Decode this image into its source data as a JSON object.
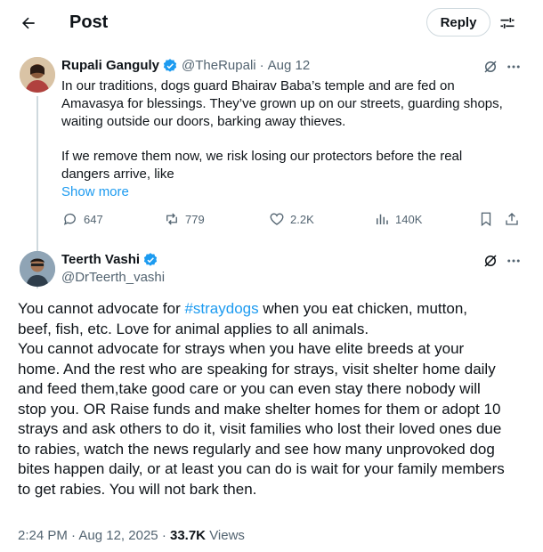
{
  "header": {
    "title": "Post",
    "reply_label": "Reply"
  },
  "parent_post": {
    "display_name": "Rupali Ganguly",
    "handle": "@TheRupali",
    "separator": "·",
    "date": "Aug 12",
    "text_lines": [
      "In our traditions, dogs guard Bhairav Baba’s temple and are fed on",
      "Amavasya for blessings. They’ve grown up on our streets, guarding shops,",
      "waiting outside our doors, barking away thieves.",
      "If we remove them now, we risk losing our protectors before the real",
      "dangers arrive, like"
    ],
    "show_more": "Show more",
    "stats": {
      "replies": "647",
      "reposts": "779",
      "likes": "2.2K",
      "views": "140K"
    }
  },
  "reply_post": {
    "display_name": "Teerth Vashi",
    "handle": "@DrTeerth_vashi",
    "body_lines": [
      {
        "before": "You cannot advocate for ",
        "hashtag": "#straydogs",
        "after": " when you eat chicken, mutton,"
      },
      "beef, fish, etc. Love for animal applies to all animals.",
      "You cannot advocate for strays when you have elite breeds at your",
      "home. And the rest who are speaking for strays, visit shelter home daily",
      "and feed them,take good care or you can even stay there nobody will",
      "stop you. OR Raise funds and make shelter homes for them or adopt 10",
      "strays and ask others to do it, visit families who lost their loved ones due",
      "to rabies, watch the news regularly and see how many unprovoked dog",
      "bites happen daily, or at least you can do is wait for your family members",
      "to get rabies. You will not bark then."
    ],
    "time": "2:24 PM",
    "date": "Aug 12, 2025",
    "separator": "·",
    "view_count": "33.7K",
    "views_label": "Views"
  },
  "icons": {
    "back": "arrow-left-icon",
    "filter": "sliders-icon",
    "verified": "verified-badge-icon",
    "grok": "grok-icon",
    "more": "more-dots-icon",
    "reply": "comment-icon",
    "repost": "repost-icon",
    "like": "heart-icon",
    "views": "analytics-icon",
    "bookmark": "bookmark-icon",
    "share": "share-icon"
  },
  "colors": {
    "accent": "#1d9bf0",
    "text": "#0f1419",
    "muted": "#536471",
    "border": "#cfd9de"
  }
}
